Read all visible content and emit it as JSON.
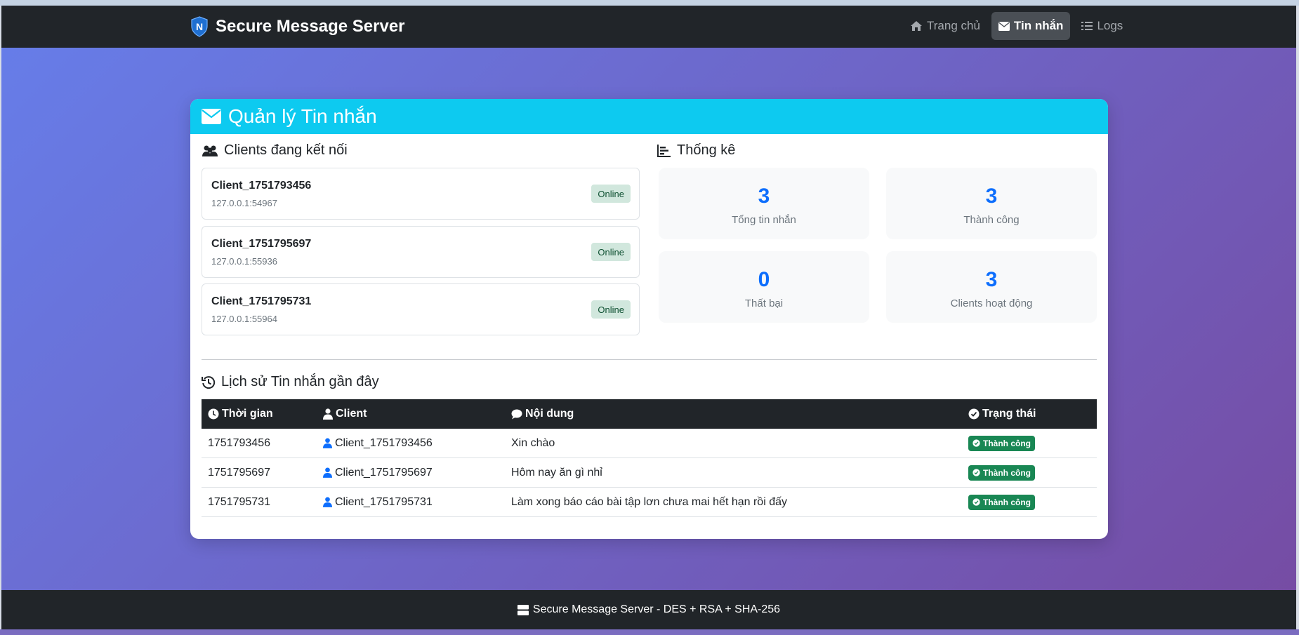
{
  "brand": {
    "logo_letter": "N",
    "title": "Secure Message Server"
  },
  "nav": [
    {
      "label": "Trang chủ",
      "icon": "home-icon",
      "active": false
    },
    {
      "label": "Tin nhắn",
      "icon": "envelope-icon",
      "active": true
    },
    {
      "label": "Logs",
      "icon": "list-icon",
      "active": false
    }
  ],
  "card": {
    "title": "Quản lý Tin nhắn"
  },
  "clients": {
    "title": "Clients đang kết nối",
    "items": [
      {
        "name": "Client_1751793456",
        "addr": "127.0.0.1:54967",
        "status": "Online"
      },
      {
        "name": "Client_1751795697",
        "addr": "127.0.0.1:55936",
        "status": "Online"
      },
      {
        "name": "Client_1751795731",
        "addr": "127.0.0.1:55964",
        "status": "Online"
      }
    ]
  },
  "stats": {
    "title": "Thống kê",
    "items": [
      {
        "value": "3",
        "label": "Tổng tin nhắn"
      },
      {
        "value": "3",
        "label": "Thành công"
      },
      {
        "value": "0",
        "label": "Thất bại"
      },
      {
        "value": "3",
        "label": "Clients hoạt động"
      }
    ]
  },
  "history": {
    "title": "Lịch sử Tin nhắn gần đây",
    "headers": {
      "time": "Thời gian",
      "client": "Client",
      "content": "Nội dung",
      "status": "Trạng thái"
    },
    "rows": [
      {
        "time": "1751793456",
        "client": "Client_1751793456",
        "content": "Xin chào",
        "status": "Thành công"
      },
      {
        "time": "1751795697",
        "client": "Client_1751795697",
        "content": "Hôm nay ăn gì nhỉ",
        "status": "Thành công"
      },
      {
        "time": "1751795731",
        "client": "Client_1751795731",
        "content": "Làm xong báo cáo bài tập lơn chưa mai hết hạn rồi đấy",
        "status": "Thành công"
      }
    ]
  },
  "footer": {
    "text": "Secure Message Server - DES + RSA + SHA-256"
  },
  "colors": {
    "accent": "#0dcaf0",
    "primary": "#0d6efd",
    "success": "#198754",
    "dark": "#212529"
  }
}
